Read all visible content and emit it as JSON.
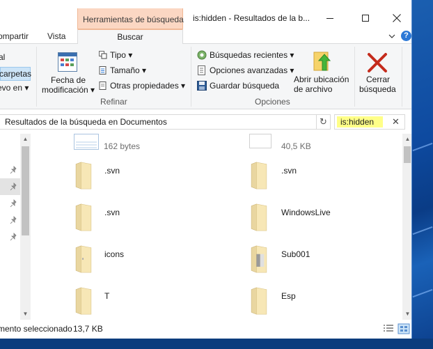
{
  "window": {
    "context_tab": "Herramientas de búsqueda",
    "title": "is:hidden - Resultados de la b..."
  },
  "tabs": {
    "compartir": "ompartir",
    "vista": "Vista",
    "buscar": "Buscar",
    "help": "?"
  },
  "ribbon": {
    "left_partial": {
      "item1": "al",
      "item2": "carpetas",
      "item3": "evo en ▾"
    },
    "refinar": {
      "fecha_line1": "Fecha de",
      "fecha_line2": "modificación ▾",
      "tipo": "Tipo ▾",
      "tamano": "Tamaño ▾",
      "otras": "Otras propiedades ▾",
      "group_label": "Refinar"
    },
    "opciones": {
      "recientes": "Búsquedas recientes ▾",
      "avanzadas": "Opciones avanzadas ▾",
      "guardar": "Guardar búsqueda",
      "abrir_line1": "Abrir ubicación",
      "abrir_line2": "de archivo",
      "cerrar_line1": "Cerrar",
      "cerrar_line2": "búsqueda",
      "group_label": "Opciones"
    }
  },
  "address": {
    "path": "Resultados de la búsqueda en Documentos",
    "refresh": "↻"
  },
  "search": {
    "value": "is:hidden",
    "clear": "✕"
  },
  "files": {
    "left": [
      {
        "name": "162 bytes",
        "kind": "size"
      },
      {
        "name": ".svn",
        "kind": "folder"
      },
      {
        "name": ".svn",
        "kind": "folder"
      },
      {
        "name": "icons",
        "kind": "folder"
      },
      {
        "name": "T",
        "kind": "folder"
      }
    ],
    "right": [
      {
        "name": "40,5 KB",
        "kind": "size"
      },
      {
        "name": ".svn",
        "kind": "folder"
      },
      {
        "name": "WindowsLive",
        "kind": "folder"
      },
      {
        "name": "Sub001",
        "kind": "folder"
      },
      {
        "name": "Esp",
        "kind": "folder"
      }
    ]
  },
  "status": {
    "selection": "mento seleccionado",
    "size": "13,7 KB"
  },
  "icons": {
    "close": "close-icon",
    "refresh": "refresh-icon",
    "pin": "pin-icon",
    "folder": "folder-icon",
    "calendar": "calendar-icon",
    "cerrar": "red-x-icon",
    "abrir": "green-arrow-icon"
  },
  "colors": {
    "context_tab": "#fbd7c3",
    "search_highlight": "#ffff88",
    "selection": "#cce4f7",
    "close_red": "#c42b1c"
  }
}
